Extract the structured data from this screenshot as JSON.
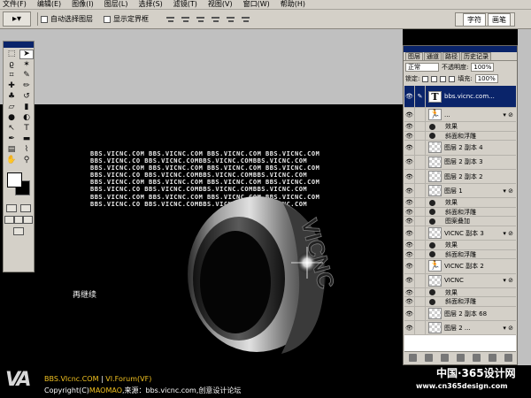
{
  "menu": [
    "文件(F)",
    "编辑(E)",
    "图像(I)",
    "图层(L)",
    "选择(S)",
    "滤镜(T)",
    "视图(V)",
    "窗口(W)",
    "帮助(H)"
  ],
  "options": {
    "auto_select_label": "自动选择图层",
    "show_bounds_label": "显示定界框"
  },
  "palette_well": {
    "tabs": [
      "字符",
      "画笔"
    ]
  },
  "layers_panel": {
    "tabs": [
      "图层",
      "通道",
      "路径",
      "历史记录"
    ],
    "blend_mode": "正常",
    "opacity_label": "不透明度:",
    "opacity_value": "100%",
    "lock_label": "锁定:",
    "fill_label": "填充:",
    "fill_value": "100%",
    "layers": [
      {
        "type": "layer",
        "thumb": "T",
        "name": "bbs.vicnc.com...",
        "selected": true,
        "fx": ""
      },
      {
        "type": "layer",
        "thumb": "runner",
        "name": "...",
        "fx": "▾ ⊘"
      },
      {
        "type": "fx",
        "name": "效果"
      },
      {
        "type": "fx",
        "name": "斜面和浮雕"
      },
      {
        "type": "layer",
        "thumb": "checker",
        "name": "图层 2 副本 4",
        "fx": ""
      },
      {
        "type": "layer",
        "thumb": "checker",
        "name": "图层 2 副本 3",
        "fx": ""
      },
      {
        "type": "layer",
        "thumb": "checker",
        "name": "图层 2 副本 2",
        "fx": ""
      },
      {
        "type": "layer",
        "thumb": "checker",
        "name": "图层 1",
        "fx": "▾ ⊘"
      },
      {
        "type": "fx",
        "name": "效果"
      },
      {
        "type": "fx",
        "name": "斜面和浮雕"
      },
      {
        "type": "fx",
        "name": "图案叠加"
      },
      {
        "type": "layer",
        "thumb": "checker",
        "name": "VICNC 副本 3",
        "fx": "▾ ⊘"
      },
      {
        "type": "fx",
        "name": "效果"
      },
      {
        "type": "fx",
        "name": "斜面和浮雕"
      },
      {
        "type": "layer",
        "thumb": "runner",
        "name": "VICNC 副本 2",
        "fx": ""
      },
      {
        "type": "layer",
        "thumb": "checker",
        "name": "VICNC",
        "fx": "▾ ⊘"
      },
      {
        "type": "fx",
        "name": "效果"
      },
      {
        "type": "fx",
        "name": "斜面和浮雕"
      },
      {
        "type": "layer",
        "thumb": "checker",
        "name": "图层 2 副本 68",
        "fx": ""
      },
      {
        "type": "layer",
        "thumb": "checker",
        "name": "图层 2 ...",
        "fx": "▾ ⊘"
      }
    ]
  },
  "canvas": {
    "watermark_lines": [
      "BBS.VICNC.COM BBS.VICNC.COM BBS.VICNC.COM BBS.VICNC.COM",
      "BBS.VICNC.CO BBS.VICNC.COMBBS.VICNC.COMBBS.VICNC.COM",
      "BBS.VICNC.COM BBS.VICNC.COM BBS.VICNC.COM BBS.VICNC.COM",
      "BBS.VICNC.CO BBS.VICNC.COMBBS.VICNC.COMBBS.VICNC.COM",
      "BBS.VICNC.COM BBS.VICNC.COM BBS.VICNC.COM BBS.VICNC.COM",
      "BBS.VICNC.CO BBS.VICNC.COMBBS.VICNC.COMBBS.VICNC.COM",
      "BBS.VICNC.COM BBS.VICNC.COM BBS.VICNC.COM BBS.VICNC.COM",
      "BBS.VICNC.CO BBS.VICNC.COMBBS.VICNC.COMBBS.VICNC.COM"
    ],
    "continue_text": "再继续",
    "ring_engraving": "VICNC"
  },
  "footer": {
    "logo": "VA",
    "line1_main": "BBS.VIcnc.COM",
    "line1_sep": " | ",
    "line1_forum": "VI.Forum(VF)",
    "line2_prefix": "Copyright(C)",
    "line2_author": "MAOMAO",
    "line2_rest": ",来源：bbs.vicnc.com,创意设计论坛",
    "site_brand": "中国·365设计网",
    "site_url": "www.cn365design.com"
  }
}
